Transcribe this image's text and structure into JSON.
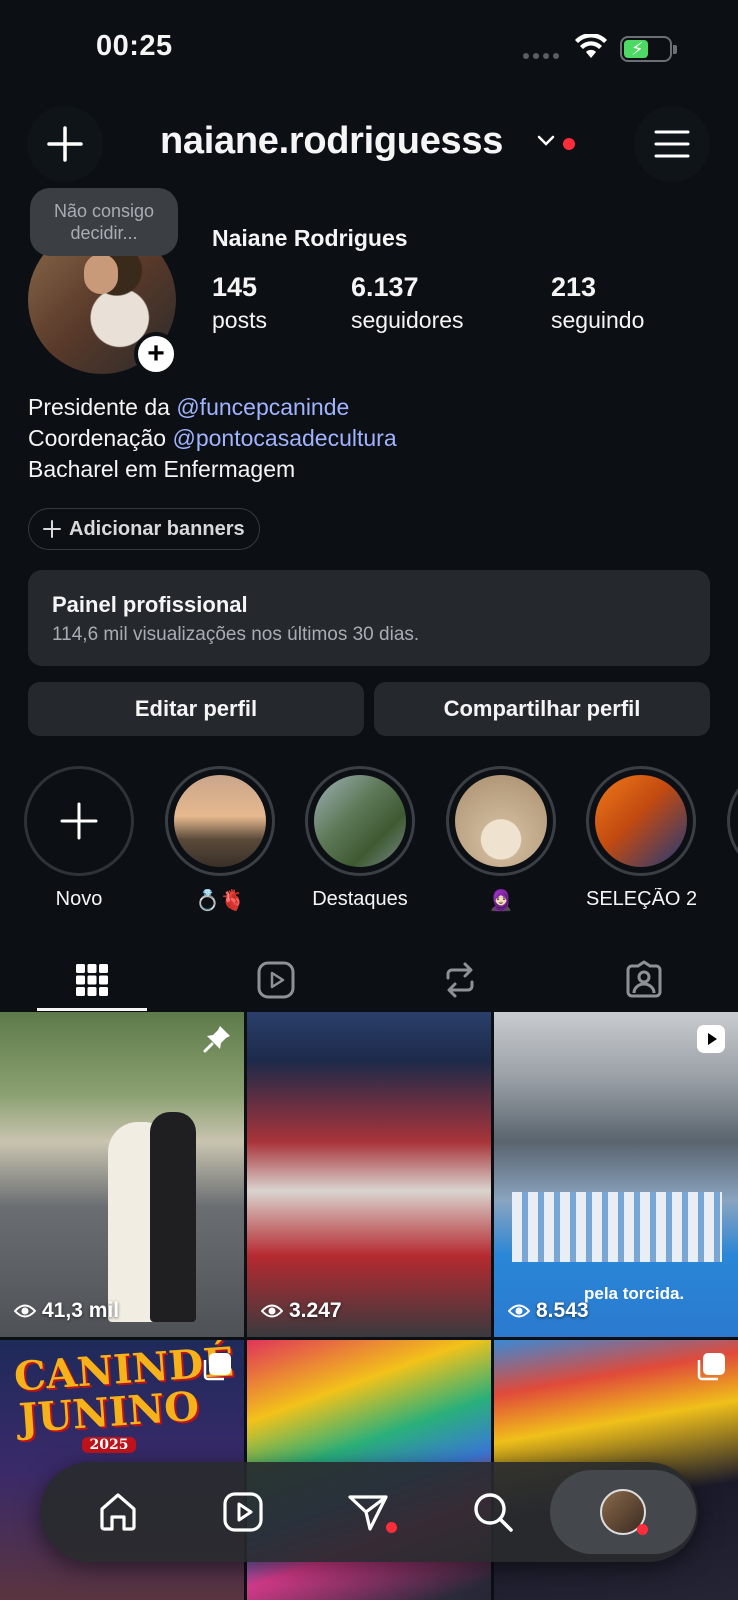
{
  "status": {
    "time": "00:25"
  },
  "header": {
    "username": "naiane.rodriguesss"
  },
  "profile": {
    "note": "Não consigo decidir...",
    "full_name": "Naiane Rodrigues",
    "stats": [
      {
        "value": "145",
        "label": "posts"
      },
      {
        "value": "6.137",
        "label": "seguidores"
      },
      {
        "value": "213",
        "label": "seguindo"
      }
    ],
    "bio": {
      "line1_prefix": "Presidente da ",
      "line1_mention": "@funcepcaninde",
      "line2_prefix": "Coordenação ",
      "line2_mention": "@pontocasadecultura",
      "line3": "Bacharel em Enfermagem"
    },
    "add_banners": "Adicionar banners"
  },
  "panel": {
    "title": "Painel profissional",
    "subtitle": "114,6 mil visualizações nos últimos 30 dias."
  },
  "actions": {
    "edit": "Editar perfil",
    "share": "Compartilhar perfil"
  },
  "highlights": [
    {
      "label": "Novo"
    },
    {
      "label": "💍🫀"
    },
    {
      "label": "Destaques"
    },
    {
      "label": "🧕🏻"
    },
    {
      "label": "SELEÇÃO 2..."
    }
  ],
  "grid": [
    {
      "views": "41,3 mil",
      "badge": "pin-icon"
    },
    {
      "views": "3.247",
      "badge": ""
    },
    {
      "views": "8.543",
      "badge": "reel-icon"
    },
    {
      "views": "",
      "badge": "carousel-icon",
      "title_line1": "CANINDÉ",
      "title_line2": "JUNINO",
      "title_line3": "2025"
    },
    {
      "views": "",
      "badge": ""
    },
    {
      "views": "",
      "badge": "carousel-icon"
    }
  ],
  "tile_text": {
    "tile3_caption": "pela torcida."
  },
  "colors": {
    "background": "#0c1014",
    "mention": "#a0b3ff",
    "notification": "#ff2d3a",
    "button": "#25292e"
  }
}
